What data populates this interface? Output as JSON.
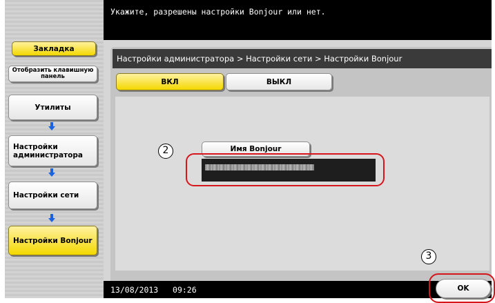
{
  "header": {
    "instruction": "Укажите, разрешены настройки Bonjour или нет."
  },
  "sidebar": {
    "bookmark_label": "Закладка",
    "keyboard_panel_label": "Отобразить клавишную панель",
    "nav": [
      {
        "label": "Утилиты"
      },
      {
        "label": "Настройки администратора"
      },
      {
        "label": "Настройки сети"
      },
      {
        "label": "Настройки Bonjour"
      }
    ]
  },
  "breadcrumb": "Настройки администратора > Настройки сети > Настройки Bonjour",
  "toggle": {
    "on_label": "ВКЛ",
    "off_label": "ВЫКЛ",
    "selected": "ВКЛ"
  },
  "bonjour_name": {
    "button_label": "Имя Bonjour"
  },
  "callouts": {
    "step2": "2",
    "step3": "3"
  },
  "footer": {
    "date": "13/08/2013",
    "time": "09:26",
    "ok_label": "OK"
  },
  "colors": {
    "selected_yellow": "#f4d800",
    "highlight_red": "#d4151b",
    "arrow_blue": "#1a63e0"
  }
}
